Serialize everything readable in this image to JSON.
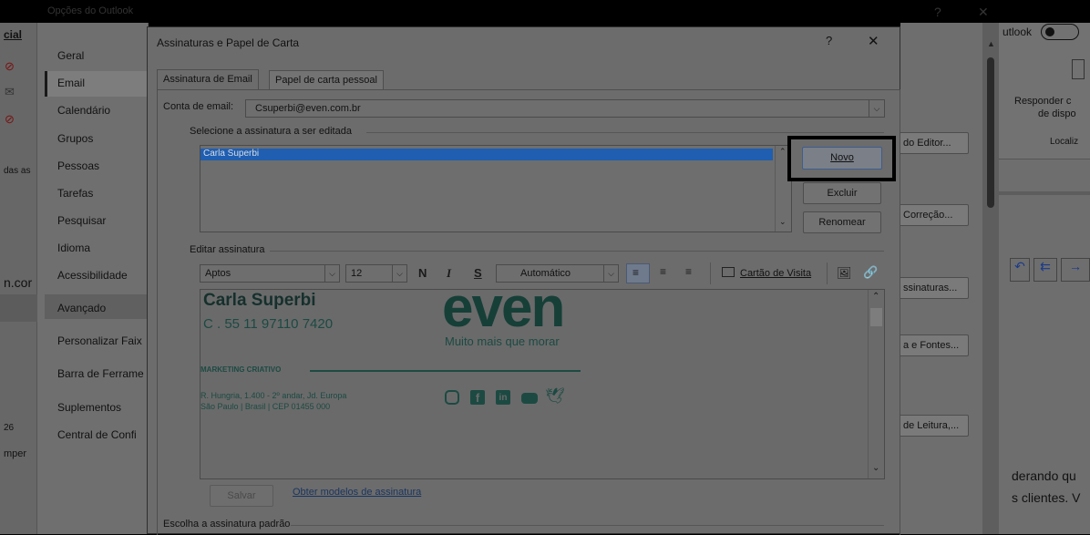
{
  "background_window": {
    "title": "Opções do Outlook",
    "left_strip": {
      "top_label": "cial",
      "middle_label": "das as",
      "bottom_label_1": "n.cor",
      "bottom_label_2": "26",
      "bottom_label_3": "mper"
    },
    "nav_items": [
      "Geral",
      "Email",
      "Calendário",
      "Grupos",
      "Pessoas",
      "Tarefas",
      "Pesquisar",
      "Idioma",
      "Acessibilidade",
      "Avançado",
      "Personalizar Faix",
      "Barra de Ferrame",
      "Suplementos",
      "Central de Confi"
    ],
    "selected_nav": "Email",
    "right_buttons": [
      "do Editor...",
      "Correção...",
      "ssinaturas...",
      "a e Fontes...",
      "de Leitura,..."
    ],
    "right_panel": {
      "toggle_label": "utlook",
      "reply_line1": "Responder c",
      "reply_line2": "de dispo",
      "localize": "Localiz",
      "text_line1": "derando qu",
      "text_line2": "s clientes. V"
    }
  },
  "dialog": {
    "title": "Assinaturas e Papel de Carta",
    "help_label": "?",
    "close_label": "✕",
    "tabs": [
      "Assinatura de Email",
      "Papel de carta pessoal"
    ],
    "account_label": "Conta de email:",
    "account_value": "Csuperbi@even.com.br",
    "select_group_label": "Selecione a assinatura a ser editada",
    "signatures": [
      "Carla Superbi"
    ],
    "buttons": {
      "new": "Novo",
      "delete": "Excluir",
      "rename": "Renomear",
      "save": "Salvar"
    },
    "edit_group_label": "Editar assinatura",
    "toolbar": {
      "font": "Aptos",
      "size": "12",
      "bold": "N",
      "italic": "I",
      "underline": "S",
      "color": "Automático",
      "business_card": "Cartão de Visita"
    },
    "signature_content": {
      "name": "Carla Superbi",
      "phone": "C . 55 11 97110 7420",
      "brand_logo": "even",
      "tagline": "Muito mais que morar",
      "department": "MARKETING CRIATIVO",
      "address_line1": "R. Hungria, 1.400 - 2º andar, Jd. Europa",
      "address_line2": "São Paulo | Brasil | CEP 01455 000"
    },
    "templates_link": "Obter modelos de assinatura",
    "default_group_label": "Escolha a assinatura padrão"
  },
  "colors": {
    "highlight_box": "#000000",
    "selection": "#1f5eb0",
    "brand_teal": "#1c4a42"
  }
}
